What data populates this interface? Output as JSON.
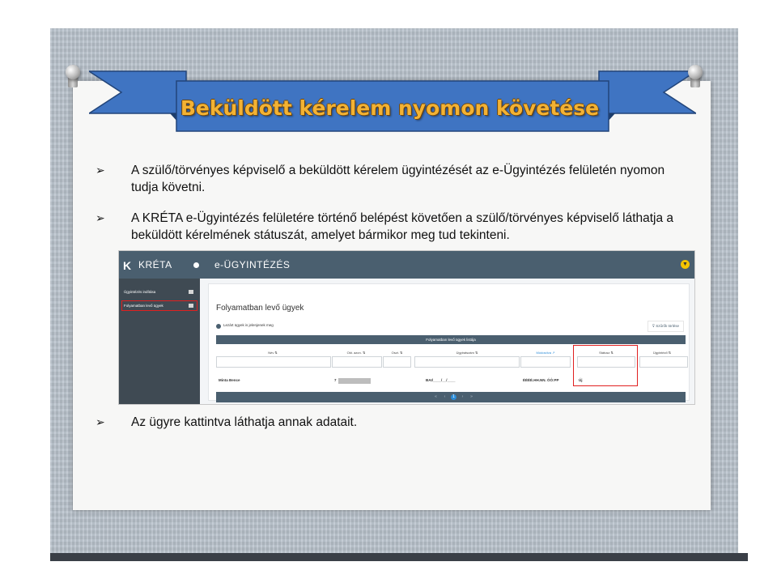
{
  "slide": {
    "title": "Beküldött kérelem nyomon követése",
    "bullets": [
      "A szülő/törvényes képviselő a beküldött kérelem ügyintézését az e-Ügyintézés felületén nyomon tudja követni.",
      "A KRÉTA e-Ügyintézés felületére történő belépést követően a szülő/törvényes képviselő láthatja a beküldött kérelmének státuszát, amelyet bármikor meg tud tekinteni.",
      "Az ügyre kattintva láthatja annak adatait."
    ],
    "bullet_glyph": "➢",
    "colors": {
      "banner": "#3f74c2",
      "title_text": "#f3b233",
      "app_header": "#4a5f6f",
      "highlight": "#e02020"
    }
  },
  "app": {
    "logo_icon": "K",
    "logo_text": "KRÉTA",
    "header_title": "e-ÜGYINTÉZÉS",
    "header_icon": "chevron-down-circle-icon",
    "sidebar": [
      {
        "label": "Ügyintézés indítása",
        "icon": "edit-icon"
      },
      {
        "label": "Folyamatban levő ügyek",
        "icon": "list-icon",
        "active": true
      }
    ],
    "page_title": "Folyamatban levő ügyek",
    "checkbox_label": "Lezárt ügyek is jelenjenek meg",
    "filter_clear": "Szűrők törlése",
    "table_title": "Folyamatban levő ügyek listája",
    "columns": [
      "Név ⇅",
      "Okt. azon. ⇅",
      "Oszt. ⇅",
      "Ügyiratszám ⇅",
      "Módosítva ↗",
      "Státusz ⇅",
      "Ügyintéző ⇅"
    ],
    "row": {
      "name": "Minta Bence",
      "okt_azon": "7",
      "ugyiratszam": "BAI/____/__/____",
      "modositva": "ÉÉÉÉ.HH.NN. ÓÓ:PP",
      "statusz": "Új"
    },
    "pager": {
      "prev2": "«",
      "prev": "‹",
      "current": "1",
      "next": "›",
      "next2": "»"
    }
  }
}
